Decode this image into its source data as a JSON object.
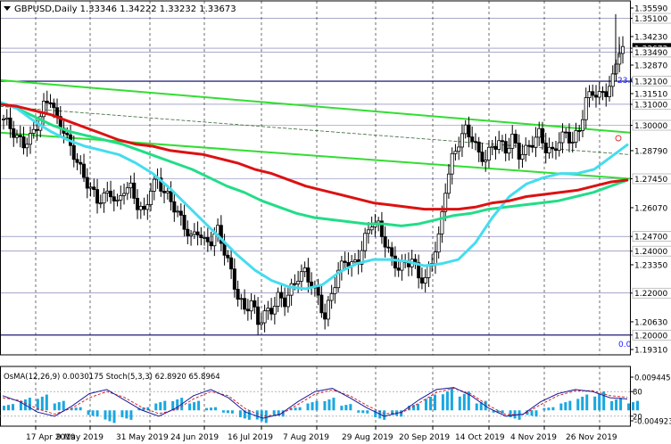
{
  "header": {
    "symbol_line": "GBPUSD,Daily  1.33346 1.34222 1.33232 1.33673"
  },
  "oscillator_header": "OsMA(12,26,9) 0.0030175  Stoch(5,3,3) 62.8920 65.8964",
  "chart_data": [
    {
      "type": "candlestick",
      "title": "GBPUSD,Daily",
      "ohlc_last": {
        "open": 1.33346,
        "high": 1.34222,
        "low": 1.33232,
        "close": 1.33673
      },
      "ylim": [
        1.1931,
        1.3559
      ],
      "y_ticks": [
        "1.35590",
        "1.35100",
        "1.34230",
        "1.33673",
        "1.33490",
        "1.32870",
        "1.32100",
        "1.31510",
        "1.31000",
        "1.30000",
        "1.28790",
        "1.27450",
        "1.26070",
        "1.24700",
        "1.24000",
        "1.23350",
        "1.22000",
        "1.20630",
        "1.20000",
        "1.19310"
      ],
      "highlighted_levels": [
        "1.35100",
        "1.33673",
        "1.33490",
        "1.32100",
        "1.31000",
        "1.30000",
        "1.27450",
        "1.24700",
        "1.24000",
        "1.22000",
        "1.20000"
      ],
      "x_ticks": [
        "17 Apr 2019",
        "9 May 2019",
        "31 May 2019",
        "24 Jun 2019",
        "16 Jul 2019",
        "7 Aug 2019",
        "29 Aug 2019",
        "20 Sep 2019",
        "14 Oct 2019",
        "4 Nov 2019",
        "26 Nov 2019"
      ],
      "fib_labels": [
        "23.6",
        "0.0"
      ],
      "series": [
        {
          "kind": "close_path",
          "values": [
            1.303,
            1.299,
            1.294,
            1.291,
            1.294,
            1.3,
            1.309,
            1.313,
            1.302,
            1.298,
            1.289,
            1.283,
            1.275,
            1.27,
            1.264,
            1.266,
            1.268,
            1.262,
            1.27,
            1.27,
            1.262,
            1.258,
            1.27,
            1.274,
            1.268,
            1.264,
            1.258,
            1.252,
            1.246,
            1.25,
            1.244,
            1.245,
            1.25,
            1.24,
            1.23,
            1.218,
            1.212,
            1.216,
            1.206,
            1.21,
            1.212,
            1.218,
            1.216,
            1.222,
            1.228,
            1.23,
            1.224,
            1.218,
            1.208,
            1.22,
            1.23,
            1.236,
            1.233,
            1.236,
            1.246,
            1.254,
            1.252,
            1.244,
            1.236,
            1.232,
            1.234,
            1.236,
            1.228,
            1.226,
            1.236,
            1.246,
            1.27,
            1.284,
            1.292,
            1.298,
            1.294,
            1.286,
            1.284,
            1.29,
            1.292,
            1.288,
            1.294,
            1.286,
            1.288,
            1.292,
            1.296,
            1.289,
            1.287,
            1.293,
            1.296,
            1.292,
            1.298,
            1.312,
            1.316,
            1.314,
            1.316,
            1.322,
            1.3367
          ]
        },
        {
          "kind": "ma_red",
          "values": [
            1.31,
            1.309,
            1.307,
            1.305,
            1.302,
            1.299,
            1.296,
            1.293,
            1.291,
            1.29,
            1.288,
            1.287,
            1.286,
            1.284,
            1.282,
            1.279,
            1.277,
            1.274,
            1.271,
            1.269,
            1.267,
            1.265,
            1.263,
            1.262,
            1.261,
            1.26,
            1.26,
            1.26,
            1.261,
            1.263,
            1.264,
            1.266,
            1.267,
            1.268,
            1.269,
            1.271,
            1.273,
            1.274
          ]
        },
        {
          "kind": "ma_green",
          "values": [
            1.311,
            1.308,
            1.304,
            1.3,
            1.297,
            1.295,
            1.293,
            1.291,
            1.288,
            1.285,
            1.282,
            1.279,
            1.275,
            1.271,
            1.268,
            1.264,
            1.261,
            1.258,
            1.256,
            1.255,
            1.254,
            1.253,
            1.253,
            1.252,
            1.253,
            1.255,
            1.257,
            1.258,
            1.26,
            1.261,
            1.262,
            1.263,
            1.264,
            1.266,
            1.268,
            1.271,
            1.274
          ]
        },
        {
          "kind": "ma_cyan",
          "values": [
            1.311,
            1.308,
            1.302,
            1.297,
            1.293,
            1.29,
            1.288,
            1.286,
            1.282,
            1.277,
            1.27,
            1.262,
            1.254,
            1.246,
            1.238,
            1.231,
            1.226,
            1.223,
            1.222,
            1.224,
            1.23,
            1.234,
            1.236,
            1.236,
            1.235,
            1.233,
            1.234,
            1.236,
            1.244,
            1.256,
            1.266,
            1.272,
            1.275,
            1.277,
            1.277,
            1.279,
            1.285,
            1.291
          ]
        }
      ]
    },
    {
      "type": "bar",
      "title": "OsMA(12,26,9) 0.0030175 Stoch(5,3,3) 62.8920 65.8964",
      "y_ticks": [
        "0.0094459",
        "80",
        "20",
        "-0.004923"
      ],
      "osma_values": [
        0.002,
        0.004,
        0.005,
        0.003,
        0.001,
        -0.002,
        -0.004,
        -0.003,
        0.001,
        0.003,
        0.004,
        0.003,
        0.001,
        -0.001,
        -0.003,
        -0.004,
        -0.002,
        0.001,
        0.003,
        0.004,
        0.002,
        -0.001,
        -0.003,
        -0.002,
        0.002,
        0.005,
        0.007,
        0.006,
        0.003,
        -0.001,
        -0.003,
        -0.002,
        0.001,
        0.003,
        0.005,
        0.006,
        0.004,
        0.003
      ],
      "stoch_main": [
        70,
        55,
        30,
        20,
        45,
        75,
        85,
        60,
        35,
        20,
        40,
        70,
        85,
        65,
        30,
        15,
        25,
        55,
        80,
        88,
        65,
        40,
        20,
        30,
        60,
        85,
        90,
        70,
        40,
        20,
        25,
        55,
        75,
        85,
        80,
        65,
        62
      ],
      "stoch_signal": [
        65,
        58,
        38,
        25,
        40,
        65,
        80,
        66,
        42,
        26,
        36,
        62,
        80,
        70,
        38,
        20,
        24,
        48,
        74,
        84,
        70,
        46,
        26,
        28,
        52,
        78,
        88,
        74,
        46,
        24,
        24,
        48,
        70,
        82,
        82,
        70,
        66
      ]
    }
  ]
}
